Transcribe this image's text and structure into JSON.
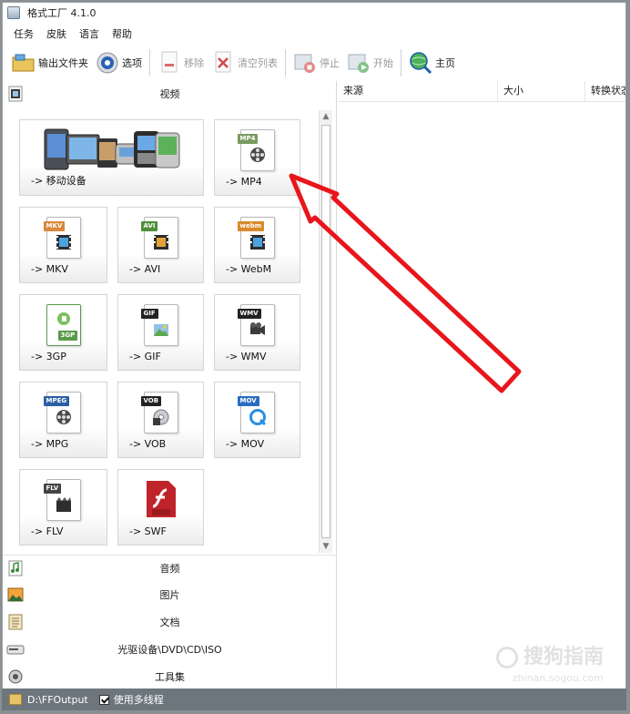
{
  "window": {
    "title": "格式工厂 4.1.0"
  },
  "menu": [
    "任务",
    "皮肤",
    "语言",
    "帮助"
  ],
  "toolbar": {
    "output_folder": "输出文件夹",
    "options": "选项",
    "remove": "移除",
    "clear_list": "清空列表",
    "stop": "停止",
    "start": "开始",
    "homepage": "主页"
  },
  "categories": {
    "video": "视频",
    "audio": "音频",
    "image": "图片",
    "document": "文档",
    "optical": "光驱设备\\DVD\\CD\\ISO",
    "tools": "工具集"
  },
  "video_formats": [
    {
      "label": "-> 移动设备",
      "tag": ""
    },
    {
      "label": "-> MP4",
      "tag": "MP4"
    },
    {
      "label": "-> MKV",
      "tag": "MKV"
    },
    {
      "label": "-> AVI",
      "tag": "AVI"
    },
    {
      "label": "-> WebM",
      "tag": "webm"
    },
    {
      "label": "-> 3GP",
      "tag": "3GP"
    },
    {
      "label": "-> GIF",
      "tag": "GIF"
    },
    {
      "label": "-> WMV",
      "tag": "WMV"
    },
    {
      "label": "-> MPG",
      "tag": "MPEG"
    },
    {
      "label": "-> VOB",
      "tag": "VOB"
    },
    {
      "label": "-> MOV",
      "tag": "MOV"
    },
    {
      "label": "-> FLV",
      "tag": "FLV"
    },
    {
      "label": "-> SWF",
      "tag": "SWF"
    }
  ],
  "task_list": {
    "columns": [
      "来源",
      "大小",
      "转换状态"
    ]
  },
  "status": {
    "output_path": "D:\\FFOutput",
    "multithread_label": "使用多线程",
    "multithread_checked": true
  },
  "watermark": {
    "brand": "搜狗指南",
    "site": "zhinan.sogou.com"
  },
  "colors": {
    "annotation_arrow": "#e8161c",
    "statusbar": "#6d767c"
  },
  "icons": {
    "toolbar": [
      "folder-icon",
      "gear-icon",
      "remove-icon",
      "clear-icon",
      "stop-icon",
      "start-icon",
      "home-globe-icon"
    ],
    "categories": [
      "video-icon",
      "music-icon",
      "image-icon",
      "document-icon",
      "disc-icon",
      "tools-icon"
    ]
  }
}
